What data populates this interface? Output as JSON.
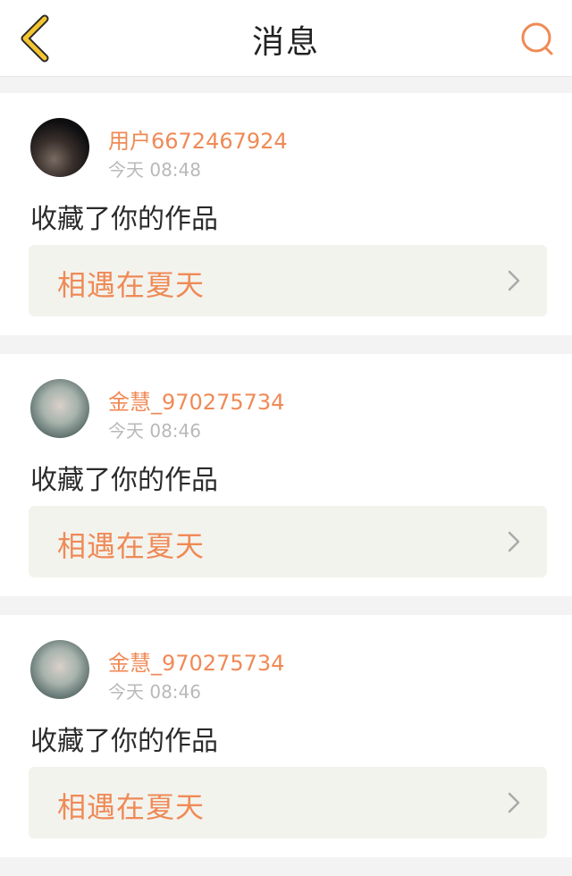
{
  "header": {
    "title": "消息",
    "back_icon": "chevron-left-icon",
    "search_icon": "search-icon",
    "accent_color": "#f5c531",
    "search_color": "#ef8a56"
  },
  "messages": [
    {
      "username": "用户6672467924",
      "time": "今天 08:48",
      "action": "收藏了你的作品",
      "work_title": "相遇在夏天"
    },
    {
      "username": "金慧_970275734",
      "time": "今天 08:46",
      "action": "收藏了你的作品",
      "work_title": "相遇在夏天"
    },
    {
      "username": "金慧_970275734",
      "time": "今天 08:46",
      "action": "收藏了你的作品",
      "work_title": "相遇在夏天"
    }
  ]
}
